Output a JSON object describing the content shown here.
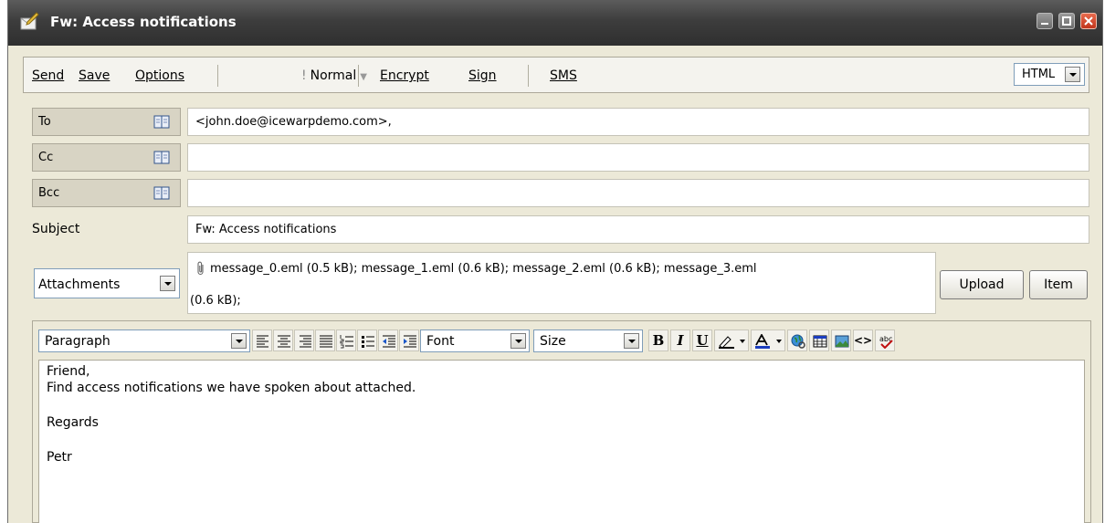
{
  "window": {
    "title": "Fw: Access notifications"
  },
  "toolbar": {
    "send_label": "Send",
    "save_label": "Save",
    "options_label": "Options",
    "priority_label": "Normal",
    "encrypt_label": "Encrypt",
    "sign_label": "Sign",
    "sms_label": "SMS",
    "format_value": "HTML"
  },
  "recipients": {
    "to_label": "To",
    "to_value": "<john.doe@icewarpdemo.com>,",
    "cc_label": "Cc",
    "cc_value": "",
    "bcc_label": "Bcc",
    "bcc_value": ""
  },
  "subject": {
    "label": "Subject",
    "value": "Fw: Access notifications"
  },
  "attachments": {
    "selector_label": "Attachments",
    "files_line1": "message_0.eml (0.5 kB); message_1.eml (0.6 kB); message_2.eml (0.6 kB); message_3.eml",
    "files_line2": "(0.6 kB);",
    "upload_label": "Upload",
    "item_label": "Item"
  },
  "editor": {
    "paragraph_select": "Paragraph",
    "font_select": "Font",
    "size_select": "Size",
    "bold_glyph": "B",
    "italic_glyph": "I",
    "underline_glyph": "U",
    "source_glyph": "<>",
    "body_lines": [
      "Friend,",
      "Find access notifications we have spoken about attached.",
      "Regards",
      "Petr"
    ]
  },
  "colors": {
    "titlebar": "#3d3d3d",
    "window_bg": "#ece9d8",
    "label_bg": "#d8d4c4",
    "close_button": "#c1361c"
  },
  "icons": [
    "compose-icon",
    "minimize-icon",
    "maximize-icon",
    "close-icon",
    "address-book-icon",
    "paperclip-icon",
    "align-left-icon",
    "align-center-icon",
    "align-right-icon",
    "justify-icon",
    "numbered-list-icon",
    "bullet-list-icon",
    "outdent-icon",
    "indent-icon",
    "highlight-icon",
    "text-color-icon",
    "link-icon",
    "table-icon",
    "image-icon",
    "spellcheck-icon"
  ]
}
